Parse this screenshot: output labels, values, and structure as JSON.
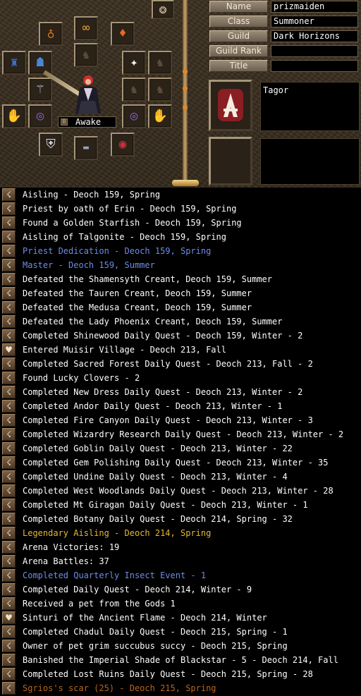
{
  "profile": {
    "labels": [
      "Name",
      "Class",
      "Guild",
      "Guild Rank",
      "Title"
    ],
    "values": [
      "prizmaiden",
      "Summoner",
      "Dark Horizons",
      "",
      ""
    ],
    "status_text": "Awake",
    "legend_text": "Tagor",
    "status_marker": "B"
  },
  "equipment_icons": {
    "top_button": "group-button-icon",
    "slots": [
      "amulet-icon",
      "earring-icon",
      "necklace-icon",
      "cloak-icon",
      "armor-icon",
      "gem-icon",
      "staff-icon",
      "glove-left-icon",
      "bracer-left-icon",
      "bracer-right-icon",
      "glove-right-icon",
      "shield-icon",
      "boots-icon",
      "belt-icon"
    ]
  },
  "colors": {
    "normal_text": "#ffffff",
    "blue_text": "#6e8ce6",
    "gold_text": "#e6b830",
    "faded_text": "#b7661d"
  },
  "legends": [
    {
      "icon": "legend-mark-icon",
      "text": "Aisling - Deoch 159, Spring",
      "color": "white"
    },
    {
      "icon": "legend-mark-icon",
      "text": "Priest by oath of Erin - Deoch 159, Spring",
      "color": "white"
    },
    {
      "icon": "legend-mark-icon",
      "text": "Found a Golden Starfish - Deoch 159, Spring",
      "color": "white"
    },
    {
      "icon": "legend-mark-icon",
      "text": "Aisling of Talgonite - Deoch 159, Spring",
      "color": "white"
    },
    {
      "icon": "legend-mark-icon",
      "text": "Priest Dedication - Deoch 159, Spring",
      "color": "blue"
    },
    {
      "icon": "legend-mark-icon",
      "text": "Master - Deoch 159, Summer",
      "color": "blue"
    },
    {
      "icon": "legend-mark-icon",
      "text": "Defeated the Shamensyth Creant, Deoch 159, Summer",
      "color": "white"
    },
    {
      "icon": "legend-mark-icon",
      "text": "Defeated the Tauren Creant, Deoch 159, Summer",
      "color": "white"
    },
    {
      "icon": "legend-mark-icon",
      "text": "Defeated the Medusa Creant, Deoch 159, Summer",
      "color": "white"
    },
    {
      "icon": "legend-mark-icon",
      "text": "Defeated the Lady Phoenix Creant, Deoch 159, Summer",
      "color": "white"
    },
    {
      "icon": "legend-mark-icon",
      "text": "Completed Shinewood Daily Quest - Deoch 159, Winter - 2",
      "color": "white"
    },
    {
      "icon": "legend-heart-icon",
      "text": "Entered Muisir Village - Deoch 213, Fall",
      "color": "white"
    },
    {
      "icon": "legend-mark-icon",
      "text": "Completed Sacred Forest Daily Quest - Deoch 213, Fall - 2",
      "color": "white"
    },
    {
      "icon": "legend-mark-icon",
      "text": "Found Lucky Clovers - 2",
      "color": "white"
    },
    {
      "icon": "legend-mark-icon",
      "text": "Completed New Dress Daily Quest - Deoch 213, Winter - 2",
      "color": "white"
    },
    {
      "icon": "legend-mark-icon",
      "text": "Completed Andor Daily Quest - Deoch 213, Winter - 1",
      "color": "white"
    },
    {
      "icon": "legend-mark-icon",
      "text": "Completed Fire Canyon Daily Quest - Deoch 213, Winter - 3",
      "color": "white"
    },
    {
      "icon": "legend-mark-icon",
      "text": "Completed Wizardry Research Daily Quest - Deoch 213, Winter - 2",
      "color": "white"
    },
    {
      "icon": "legend-mark-icon",
      "text": "Completed Goblin Daily Quest - Deoch 213, Winter - 22",
      "color": "white"
    },
    {
      "icon": "legend-mark-icon",
      "text": "Completed Gem Polishing Daily Quest - Deoch 213, Winter - 35",
      "color": "white"
    },
    {
      "icon": "legend-mark-icon",
      "text": "Completed Undine Daily Quest - Deoch 213, Winter - 4",
      "color": "white"
    },
    {
      "icon": "legend-mark-icon",
      "text": "Completed West Woodlands Daily Quest - Deoch 213, Winter - 28",
      "color": "white"
    },
    {
      "icon": "legend-mark-icon",
      "text": "Completed Mt Giragan Daily Quest - Deoch 213, Winter - 1",
      "color": "white"
    },
    {
      "icon": "legend-mark-icon",
      "text": "Completed Botany Daily Quest - Deoch 214, Spring - 32",
      "color": "white"
    },
    {
      "icon": "legend-mark-icon",
      "text": "Legendary Aisling - Deoch 214, Spring",
      "color": "gold"
    },
    {
      "icon": "legend-mark-icon",
      "text": "Arena Victories: 19",
      "color": "white"
    },
    {
      "icon": "legend-mark-icon",
      "text": "Arena Battles: 37",
      "color": "white"
    },
    {
      "icon": "legend-mark-icon",
      "text": "Completed Quarterly Insect Event - 1",
      "color": "blue"
    },
    {
      "icon": "legend-mark-icon",
      "text": "Completed Daily Quest - Deoch 214, Winter - 9",
      "color": "white"
    },
    {
      "icon": "legend-mark-icon",
      "text": "Received a pet from the Gods 1",
      "color": "white"
    },
    {
      "icon": "legend-heart-icon",
      "text": "Sinturi of the Ancient Flame - Deoch 214, Winter",
      "color": "white"
    },
    {
      "icon": "legend-mark-icon",
      "text": "Completed Chadul Daily Quest - Deoch 215, Spring - 1",
      "color": "white"
    },
    {
      "icon": "legend-mark-icon",
      "text": "Owner of pet grim succubus succy - Deoch 215, Spring",
      "color": "white"
    },
    {
      "icon": "legend-mark-icon",
      "text": "Banished the Imperial Shade of Blackstar - 5 - Deoch 214, Fall",
      "color": "white"
    },
    {
      "icon": "legend-mark-icon",
      "text": "Completed Lost Ruins Daily Quest - Deoch 215, Spring - 28",
      "color": "white"
    },
    {
      "icon": "legend-mark-icon",
      "text": "Sgrios's scar (25) - Deoch 215, Spring",
      "color": "dim"
    }
  ]
}
